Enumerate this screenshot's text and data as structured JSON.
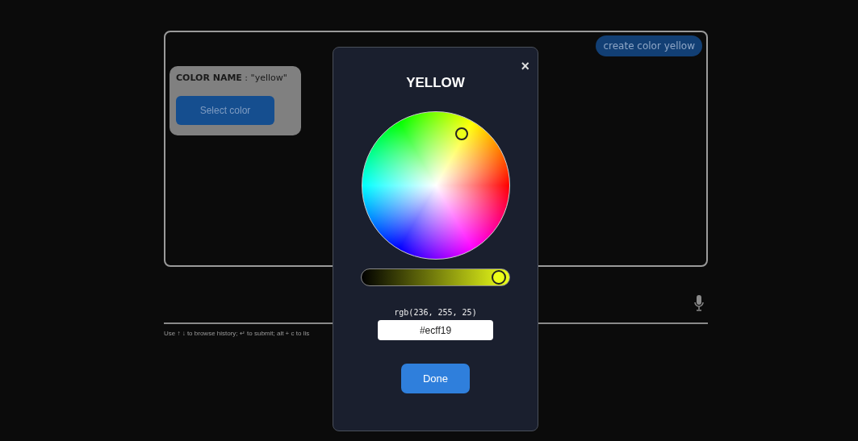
{
  "panel": {
    "create_button": "create color yellow",
    "card": {
      "label": "COLOR NAME",
      "value": " : \"yellow\"",
      "button": "Select color"
    }
  },
  "input": {
    "hint": "Use ↑ ↓ to browse history; ↵ to submit; alt + c to lis"
  },
  "dialog": {
    "title": "YELLOW",
    "close": "×",
    "brightness": {
      "level": 0.93
    },
    "rgb": "rgb(236, 255, 25)",
    "hex": "#ecff19",
    "button": "Done"
  }
}
